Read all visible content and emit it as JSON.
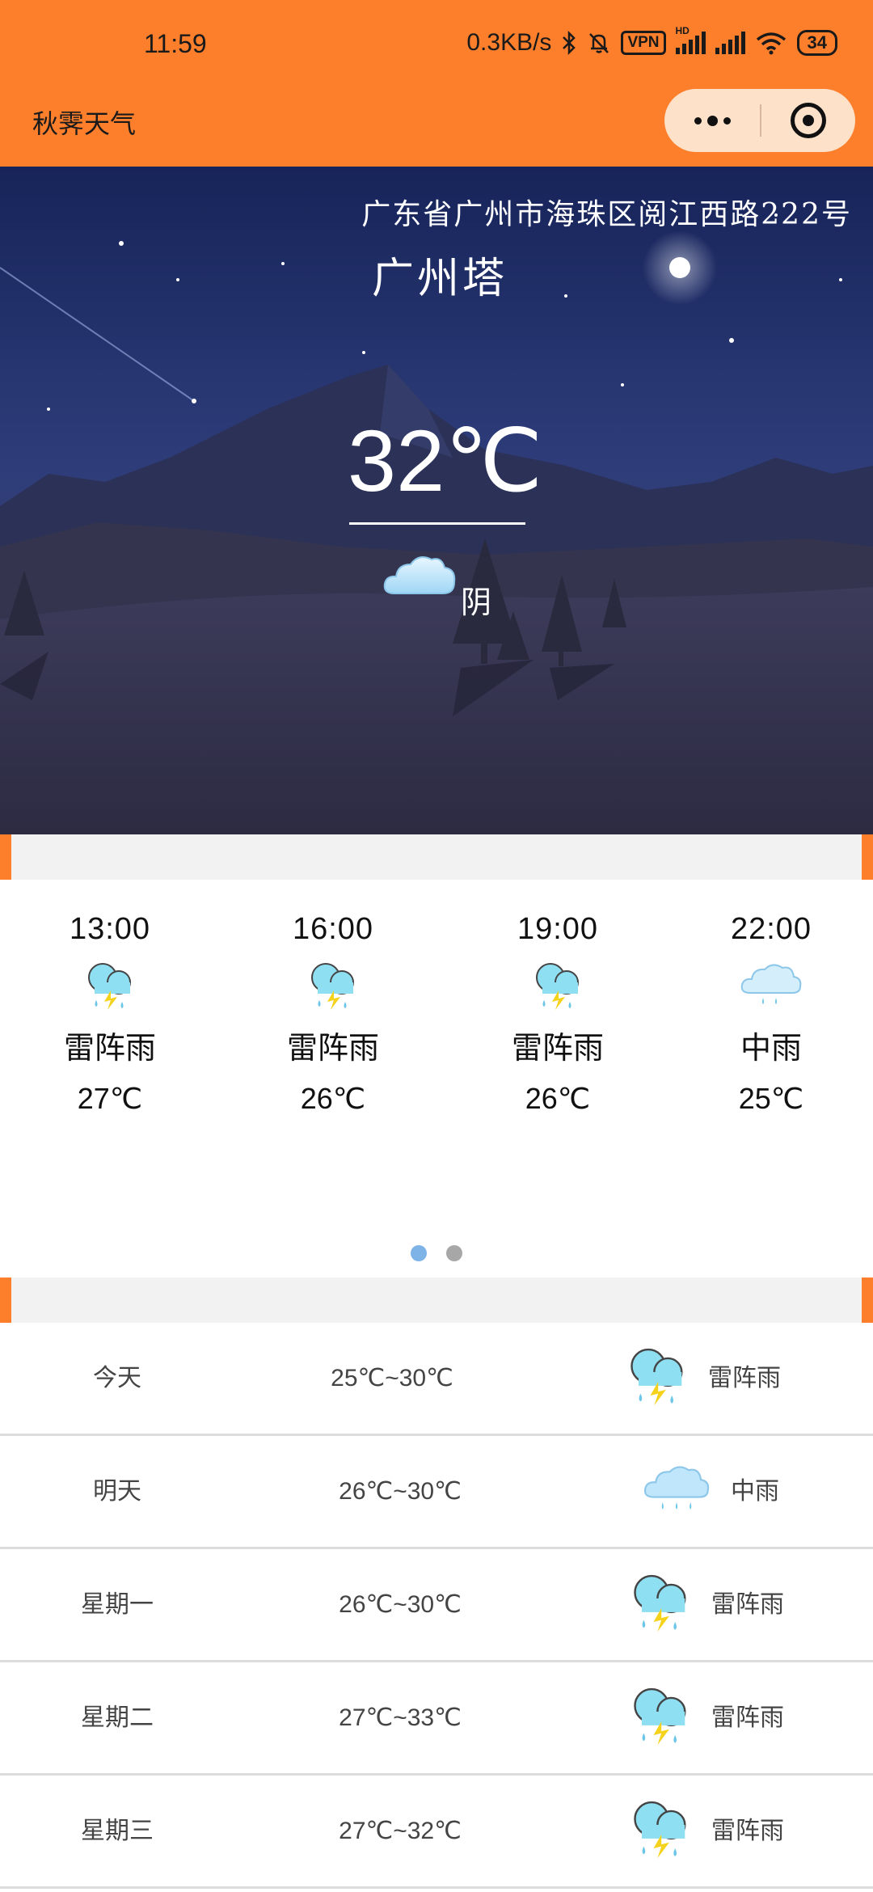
{
  "status_bar": {
    "time": "11:59",
    "network_speed": "0.3KB/s",
    "vpn": "VPN",
    "hd": "HD",
    "battery": "34"
  },
  "nav": {
    "title": "秋霁天气",
    "more_icon": "more-dots-icon",
    "close_icon": "target-close-icon"
  },
  "current": {
    "address": "广东省广州市海珠区阅江西路222号",
    "place": "广州塔",
    "temperature": "32℃",
    "condition": "阴",
    "icon": "cloud-icon"
  },
  "hourly": [
    {
      "time": "13:00",
      "condition": "雷阵雨",
      "temp": "27℃",
      "icon": "thunder-rain-icon"
    },
    {
      "time": "16:00",
      "condition": "雷阵雨",
      "temp": "26℃",
      "icon": "thunder-rain-icon"
    },
    {
      "time": "19:00",
      "condition": "雷阵雨",
      "temp": "26℃",
      "icon": "thunder-rain-icon"
    },
    {
      "time": "22:00",
      "condition": "中雨",
      "temp": "25℃",
      "icon": "moderate-rain-icon"
    }
  ],
  "carousel": {
    "pages": 2,
    "active_page": 1
  },
  "daily": [
    {
      "day": "今天",
      "range": "25℃~30℃",
      "condition": "雷阵雨",
      "icon": "thunder-rain-icon"
    },
    {
      "day": "明天",
      "range": "26℃~30℃",
      "condition": "中雨",
      "icon": "moderate-rain-icon"
    },
    {
      "day": "星期一",
      "range": "26℃~30℃",
      "condition": "雷阵雨",
      "icon": "thunder-rain-icon"
    },
    {
      "day": "星期二",
      "range": "27℃~33℃",
      "condition": "雷阵雨",
      "icon": "thunder-rain-icon"
    },
    {
      "day": "星期三",
      "range": "27℃~32℃",
      "condition": "雷阵雨",
      "icon": "thunder-rain-icon"
    }
  ],
  "colors": {
    "accent": "#fd7f2c",
    "capsule": "#fde1c9",
    "sky_top": "#1c2a5a",
    "separator": "#f2f2f2",
    "dot_active": "#7db3e6",
    "dot_inactive": "#a7a7a7"
  }
}
